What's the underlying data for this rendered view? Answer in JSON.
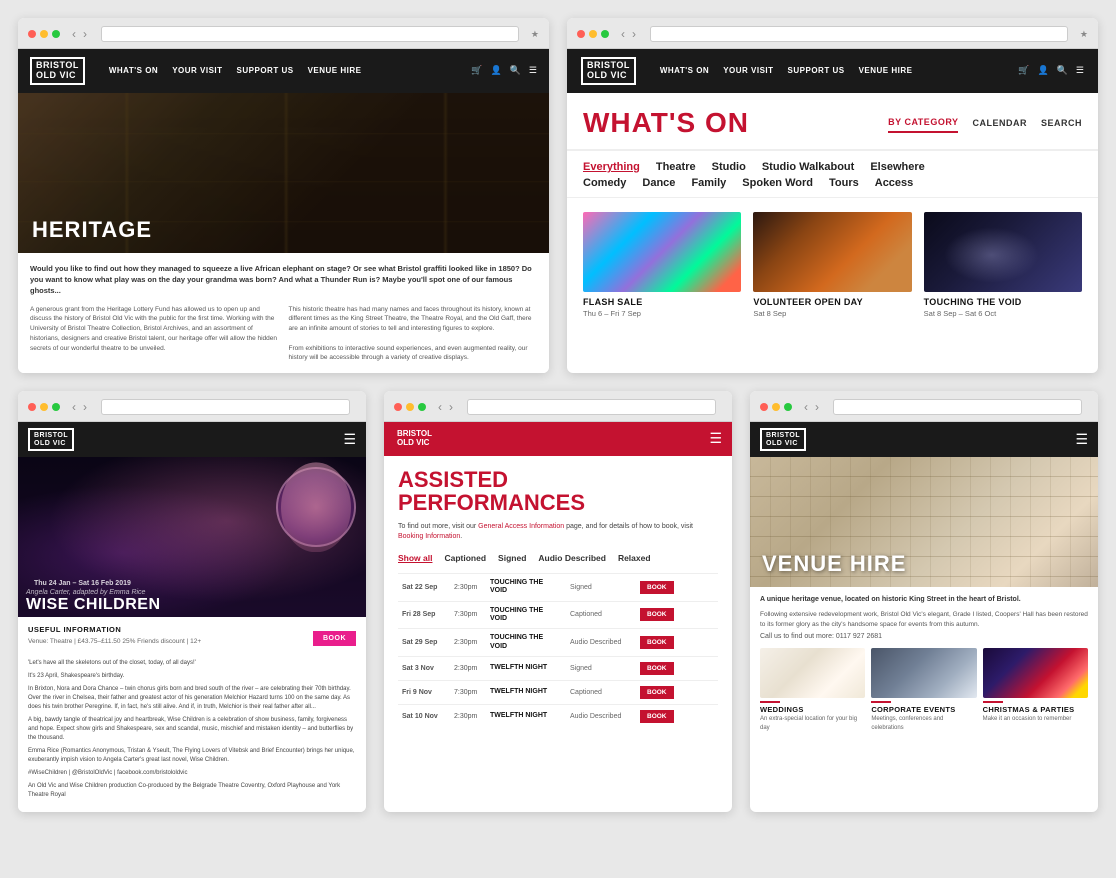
{
  "page": {
    "background": "#e8e8e8"
  },
  "topLeft": {
    "title": "Heritage Page",
    "nav": {
      "logo": "BRISTOL\nOLD VIC",
      "links": [
        "WHAT'S ON",
        "YOUR VISIT",
        "SUPPORT US",
        "VENUE HIRE"
      ]
    },
    "hero": {
      "title": "HERITAGE"
    },
    "intro": "Would you like to find out how they managed to squeeze a live African elephant on stage? Or see what Bristol graffiti looked like in 1850? Do you want to know what play was on the day your grandma was born? And what a Thunder Run is? Maybe you'll spot one of our famous ghosts...",
    "col1": "A generous grant from the Heritage Lottery Fund has allowed us to open up and discuss the history of Bristol Old Vic with the public for the first time. Working with the University of Bristol Theatre Collection, Bristol Archives, and an assortment of historians, designers and creative Bristol talent, our heritage offer will allow the hidden secrets of our wonderful theatre to be unveiled.",
    "col2": "This historic theatre has had many names and faces throughout its history, known at different times as the King Street Theatre, the Theatre Royal, and the Old Gaff, there are an infinite amount of stories to tell and interesting figures to explore.\n\nFrom exhibitions to interactive sound experiences, and even augmented reality, our history will be accessible through a variety of creative displays."
  },
  "topRight": {
    "title": "WHAT'S ON",
    "nav": {
      "logo": "BRISTOL\nOLD VIC",
      "links": [
        "WHAT'S ON",
        "YOUR VISIT",
        "SUPPORT US",
        "VENUE HIRE"
      ]
    },
    "tabs": {
      "byCategory": "BY CATEGORY",
      "calendar": "CALENDAR",
      "search": "SEARCH"
    },
    "categories": {
      "row1": [
        "Everything",
        "Theatre",
        "Studio",
        "Studio Walkabout",
        "Elsewhere"
      ],
      "row2": [
        "Comedy",
        "Dance",
        "Family",
        "Spoken Word",
        "Tours",
        "Access"
      ]
    },
    "events": [
      {
        "type": "flash",
        "title": "FLASH SALE",
        "date": "Thu 6 – Fri 7 Sep"
      },
      {
        "type": "volunteer",
        "title": "VOLUNTEER OPEN DAY",
        "date": "Sat 8 Sep"
      },
      {
        "type": "void",
        "title": "TOUCHING THE VOID",
        "date": "Sat 8 Sep – Sat 6 Oct"
      }
    ]
  },
  "bottomLeft": {
    "title": "Wise Children Page",
    "dates": "Thu 24 Jan – Sat 16 Feb 2019",
    "subtitle": "Angela Carter, adapted by Emma Rice",
    "showTitle": "WISE CHILDREN",
    "usefulInfo": {
      "header": "USEFUL INFORMATION",
      "meta": "Venue: Theatre  |  £43.75–£11.50  25% Friends discount  |  12+"
    },
    "bookLabel": "BOOK",
    "bodyText": [
      "'Let's have all the skeletons out of the closet, today, of all days!'",
      "It's 23 April, Shakespeare's birthday.",
      "In Brixton, Nora and Dora Chance – twin chorus girls born and bred south of the river – are celebrating their 70th birthday. Over the river in Chelsea, their father and greatest actor of his generation Melchior Hazard turns 100 on the same day. As does his twin brother Peregrine. If, in fact, he's still alive. And if, in truth, Melchior is their real father after all...",
      "A big, bawdy tangle of theatrical joy and heartbreak, Wise Children is a celebration of show business, family, forgiveness and hope. Expect show girls and Shakespeare, sex and scandal, music, mischief and mistaken identity – and butterflies by the thousand.",
      "Emma Rice (Romantics Anonymous, Tristan & Yseult, The Flying Lovers of Vitebsk and Brief Encounter) brings her unique, exuberantly impish vision to Angela Carter's great last novel, Wise Children."
    ],
    "hashtag": "#WiseChildren | @BristolOldVic | facebook.com/bristololdvic",
    "footer": "An Old Vic and Wise Children production\nCo-produced by the Belgrade Theatre Coventry, Oxford Playhouse and York Theatre Royal"
  },
  "bottomMiddle": {
    "title": "Assisted Performances Page",
    "pageTitle": "ASSISTED\nPERFORMANCES",
    "intro": "To find out more, visit our General Access Information page, and for details of how to book, visit Booking Information.",
    "filters": [
      "Show all",
      "Captioned",
      "Signed",
      "Audio Described",
      "Relaxed"
    ],
    "performances": [
      {
        "date": "Sat 22 Sep",
        "time": "2:30pm",
        "show": "TOUCHING THE VOID",
        "type": "Signed"
      },
      {
        "date": "Fri 28 Sep",
        "time": "7:30pm",
        "show": "TOUCHING THE VOID",
        "type": "Captioned"
      },
      {
        "date": "Sat 29 Sep",
        "time": "2:30pm",
        "show": "TOUCHING THE VOID",
        "type": "Audio Described"
      },
      {
        "date": "Sat 3 Nov",
        "time": "2:30pm",
        "show": "TWELFTH NIGHT",
        "type": "Signed"
      },
      {
        "date": "Fri 9 Nov",
        "time": "7:30pm",
        "show": "TWELFTH NIGHT",
        "type": "Captioned"
      },
      {
        "date": "Sat 10 Nov",
        "time": "2:30pm",
        "show": "TWELFTH NIGHT",
        "type": "Audio Described"
      }
    ],
    "bookLabel": "BOOK"
  },
  "bottomRight": {
    "title": "Venue Hire Page",
    "heroTitle": "VENUE HIRE",
    "desc": "A unique heritage venue, located on historic King Street in the heart of Bristol.",
    "subdesc": "Following extensive redevelopment work, Bristol Old Vic's elegant, Grade I listed, Coopers' Hall has been restored to its former glory as the city's handsome space for events from this autumn.",
    "phone": "Call us to find out more: 0117 927 2681",
    "cards": [
      {
        "type": "weddings",
        "title": "WEDDINGS",
        "sub": "An extra-special location for your big day"
      },
      {
        "type": "corporate",
        "title": "CORPORATE EVENTS",
        "sub": "Meetings, conferences and celebrations"
      },
      {
        "type": "xmas",
        "title": "CHRISTMAS & PARTIES",
        "sub": "Make it an occasion to remember"
      }
    ]
  }
}
